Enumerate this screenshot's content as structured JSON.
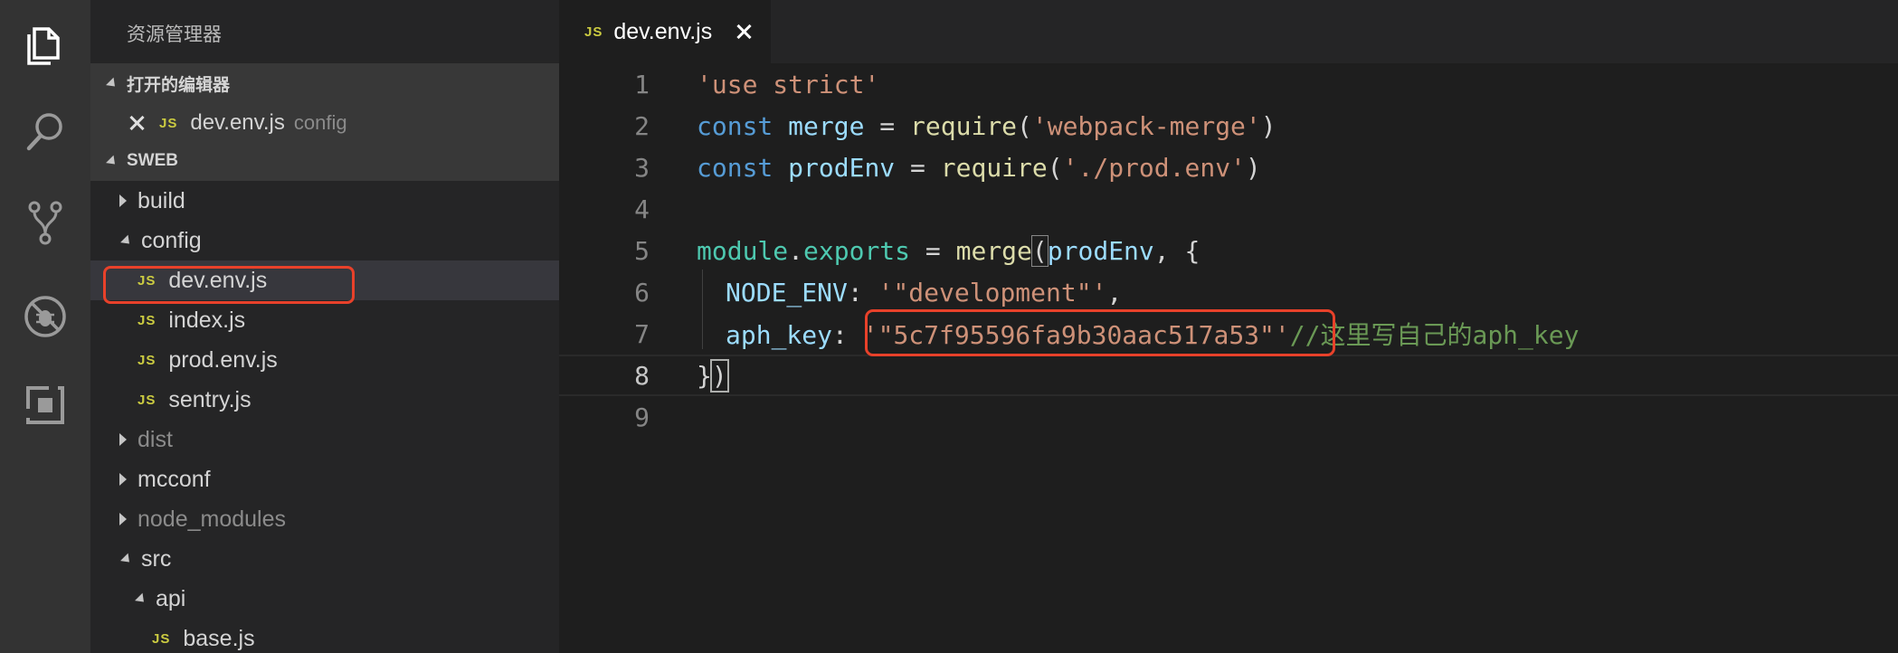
{
  "activity_bar": {
    "icons": [
      "files-icon",
      "search-icon",
      "source-control-icon",
      "debug-icon",
      "extensions-icon"
    ]
  },
  "sidebar": {
    "title": "资源管理器",
    "open_editors": {
      "header": "打开的编辑器",
      "item": {
        "badge": "JS",
        "name": "dev.env.js",
        "folder": "config"
      }
    },
    "project": {
      "header": "SWEB",
      "tree": [
        {
          "label": "build",
          "type": "folder",
          "expanded": false,
          "muted": false
        },
        {
          "label": "config",
          "type": "folder",
          "expanded": true,
          "muted": false
        },
        {
          "label": "dev.env.js",
          "type": "js",
          "selected": true
        },
        {
          "label": "index.js",
          "type": "js"
        },
        {
          "label": "prod.env.js",
          "type": "js"
        },
        {
          "label": "sentry.js",
          "type": "js"
        },
        {
          "label": "dist",
          "type": "folder",
          "expanded": false,
          "muted": true
        },
        {
          "label": "mcconf",
          "type": "folder",
          "expanded": false,
          "muted": false
        },
        {
          "label": "node_modules",
          "type": "folder",
          "expanded": false,
          "muted": true
        },
        {
          "label": "src",
          "type": "folder",
          "expanded": true,
          "muted": false
        },
        {
          "label": "api",
          "type": "folder",
          "expanded": true,
          "muted": false
        },
        {
          "label": "base.js",
          "type": "js"
        }
      ]
    }
  },
  "tab": {
    "badge": "JS",
    "name": "dev.env.js"
  },
  "editor": {
    "line_numbers": [
      "1",
      "2",
      "3",
      "4",
      "5",
      "6",
      "7",
      "8",
      "9"
    ],
    "current_line": "8",
    "code": {
      "l1": "'use strict'",
      "l2_kw": "const",
      "l2_var": "merge",
      "l2_eq": " = ",
      "l2_fn": "require",
      "l2_open": "(",
      "l2_str": "'webpack-merge'",
      "l2_close": ")",
      "l3_kw": "const",
      "l3_var": "prodEnv",
      "l3_eq": " = ",
      "l3_fn": "require",
      "l3_open": "(",
      "l3_str": "'./prod.env'",
      "l3_close": ")",
      "l5_mod": "module",
      "l5_dot": ".",
      "l5_exp": "exports",
      "l5_eq": " = ",
      "l5_fn": "merge",
      "l5_open": "(",
      "l5_var": "prodEnv",
      "l5_rest": ", {",
      "l6_key": "NODE_ENV",
      "l6_colon": ": ",
      "l6_str": "'\"development\"'",
      "l6_comma": ",",
      "l7_key": "aph_key",
      "l7_colon": ": ",
      "l7_str": "'\"5c7f95596fa9b30aac517a53\"'",
      "l7_comment": "//这里写自己的aph_key",
      "l8_brace": "}",
      "l8_paren": ")"
    }
  },
  "colors": {
    "highlight_box": "#e8412a",
    "js_badge": "#cbcb41"
  }
}
